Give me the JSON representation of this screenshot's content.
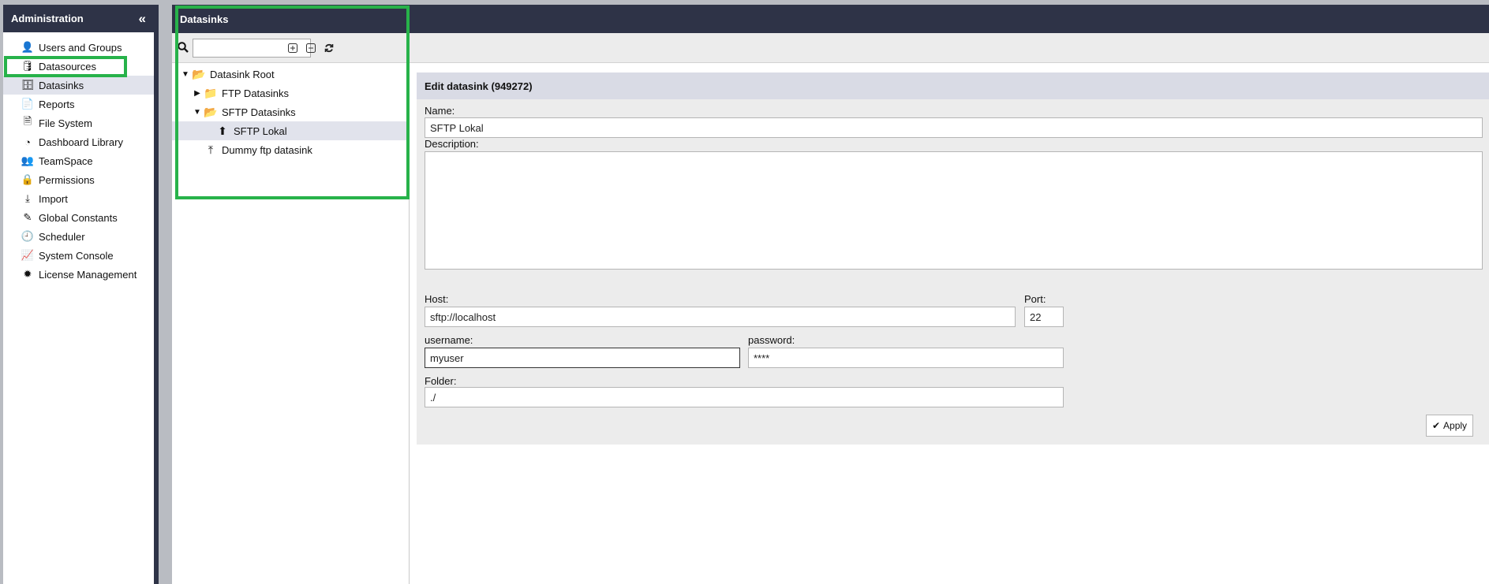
{
  "admin": {
    "title": "Administration",
    "collapse_glyph": "«",
    "items": [
      {
        "label": "Users and Groups",
        "icon": "user-icon",
        "glyph": "👤"
      },
      {
        "label": "Datasources",
        "icon": "database-icon",
        "glyph": "🛢"
      },
      {
        "label": "Datasinks",
        "icon": "server-icon",
        "glyph": "🗄"
      },
      {
        "label": "Reports",
        "icon": "file-icon",
        "glyph": "📄"
      },
      {
        "label": "File System",
        "icon": "file-text-icon",
        "glyph": "🗎"
      },
      {
        "label": "Dashboard Library",
        "icon": "dashboard-icon",
        "glyph": "◔"
      },
      {
        "label": "TeamSpace",
        "icon": "users-icon",
        "glyph": "👥"
      },
      {
        "label": "Permissions",
        "icon": "lock-icon",
        "glyph": "🔒"
      },
      {
        "label": "Import",
        "icon": "download-icon",
        "glyph": "⤓"
      },
      {
        "label": "Global Constants",
        "icon": "edit-icon",
        "glyph": "✎"
      },
      {
        "label": "Scheduler",
        "icon": "clock-icon",
        "glyph": "🕘"
      },
      {
        "label": "System Console",
        "icon": "area-chart-icon",
        "glyph": "📈"
      },
      {
        "label": "License Management",
        "icon": "certificate-icon",
        "glyph": "✹"
      }
    ]
  },
  "datasinks": {
    "title": "Datasinks",
    "search": {
      "value": "",
      "placeholder": ""
    },
    "tree": [
      {
        "label": "Datasink Root",
        "level": 0,
        "toggle": "▼",
        "icon": "folder-open-icon",
        "glyph": "📂"
      },
      {
        "label": "FTP Datasinks",
        "level": 1,
        "toggle": "▶",
        "icon": "folder-icon",
        "glyph": "📁"
      },
      {
        "label": "SFTP Datasinks",
        "level": 1,
        "toggle": "▼",
        "icon": "folder-open-icon",
        "glyph": "📂"
      },
      {
        "label": "SFTP Lokal",
        "level": 2,
        "toggle": "",
        "icon": "upload-circle-icon",
        "glyph": "⬆"
      },
      {
        "label": "Dummy ftp datasink",
        "level": 1,
        "toggle": "",
        "icon": "upload-icon",
        "glyph": "⤒"
      }
    ]
  },
  "edit": {
    "title": "Edit datasink (949272)",
    "name_label": "Name:",
    "name_value": "SFTP Lokal",
    "description_label": "Description:",
    "description_value": "",
    "host_label": "Host:",
    "host_value": "sftp://localhost",
    "port_label": "Port:",
    "port_value": "22",
    "username_label": "username:",
    "username_value": "myuser",
    "password_label": "password:",
    "password_value": "****",
    "folder_label": "Folder:",
    "folder_value": "./",
    "apply_label": "Apply"
  }
}
